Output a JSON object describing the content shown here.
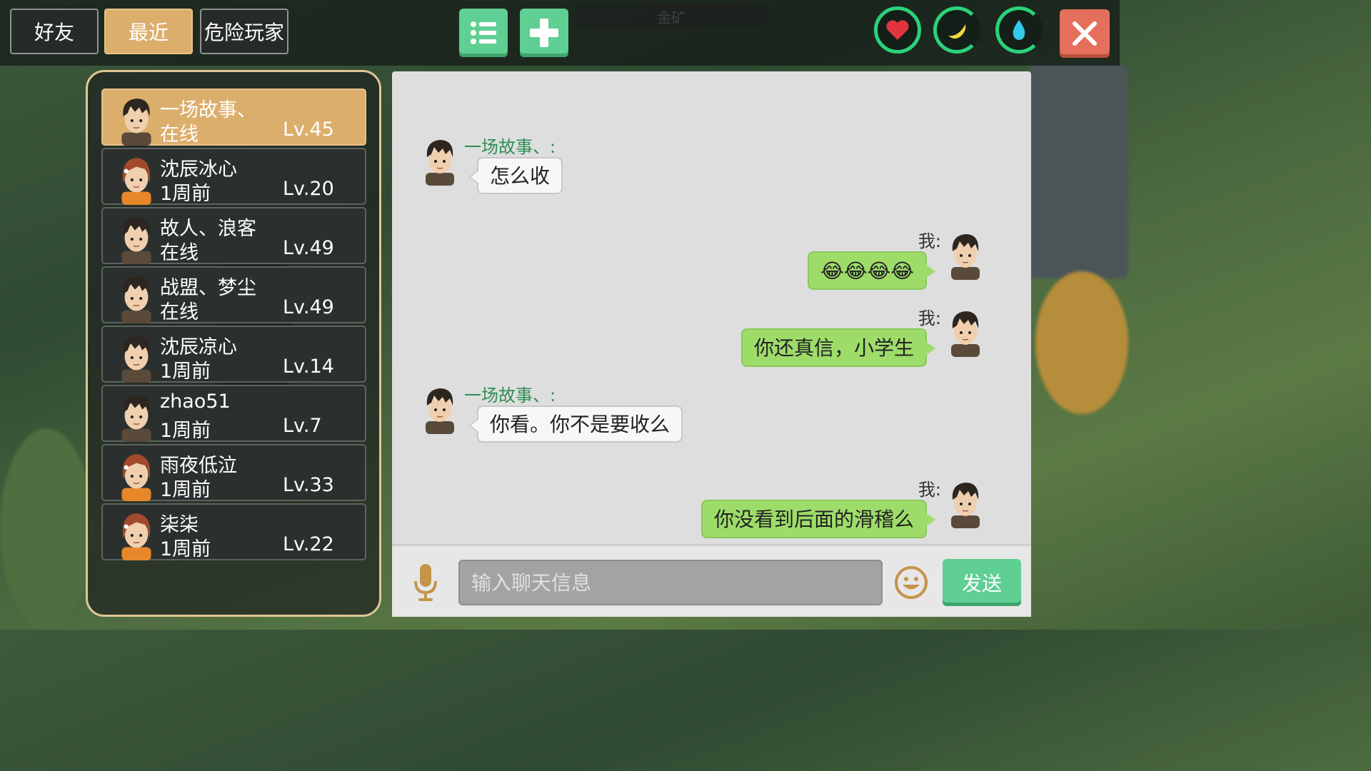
{
  "top_tabs": [
    {
      "label": "好友",
      "active": false
    },
    {
      "label": "最近",
      "active": true
    },
    {
      "label": "危险玩家",
      "active": false
    }
  ],
  "toolbar": {
    "list_icon": "list-icon",
    "add_icon": "plus-icon",
    "heart_icon": "heart-icon",
    "banana_icon": "banana-icon",
    "water_icon": "water-drop-icon",
    "close_icon": "close-icon",
    "banner_text": "金矿"
  },
  "colors": {
    "accent_gold": "#dcae6c",
    "accent_green": "#5fcf93",
    "ring_green": "#2bd27a",
    "close_red": "#e4705c",
    "bubble_green": "#9edc6a",
    "sender_green": "#2f8e55"
  },
  "friends": [
    {
      "name": "一场故事、",
      "status": "在线",
      "level": "Lv.45",
      "avatar": "boy-avatar",
      "selected": true
    },
    {
      "name": "沈辰冰心",
      "status": "1周前",
      "level": "Lv.20",
      "avatar": "girl-avatar",
      "selected": false
    },
    {
      "name": "故人、浪客",
      "status": "在线",
      "level": "Lv.49",
      "avatar": "boy-avatar",
      "selected": false
    },
    {
      "name": "战盟、梦尘",
      "status": "在线",
      "level": "Lv.49",
      "avatar": "boy-avatar",
      "selected": false
    },
    {
      "name": "沈辰凉心",
      "status": "1周前",
      "level": "Lv.14",
      "avatar": "boy-avatar",
      "selected": false
    },
    {
      "name": "zhao51",
      "status": "1周前",
      "level": "Lv.7",
      "avatar": "boy-avatar",
      "selected": false
    },
    {
      "name": "雨夜低泣",
      "status": "1周前",
      "level": "Lv.33",
      "avatar": "girl-avatar",
      "selected": false
    },
    {
      "name": "柒柒",
      "status": "1周前",
      "level": "Lv.22",
      "avatar": "girl-avatar",
      "selected": false
    }
  ],
  "messages": [
    {
      "side": "left",
      "sender": "一场故事、:",
      "text": "怎么收"
    },
    {
      "side": "right",
      "sender": "我:",
      "text": "😂😂😂😂"
    },
    {
      "side": "right",
      "sender": "我:",
      "text": "你还真信，小学生"
    },
    {
      "side": "left",
      "sender": "一场故事、:",
      "text": "你看。你不是要收么"
    },
    {
      "side": "right",
      "sender": "我:",
      "text": "你没看到后面的滑稽么"
    }
  ],
  "input": {
    "placeholder": "输入聊天信息",
    "value": "",
    "send_label": "发送",
    "mic_icon": "microphone-icon",
    "emoji_icon": "smiley-icon"
  }
}
